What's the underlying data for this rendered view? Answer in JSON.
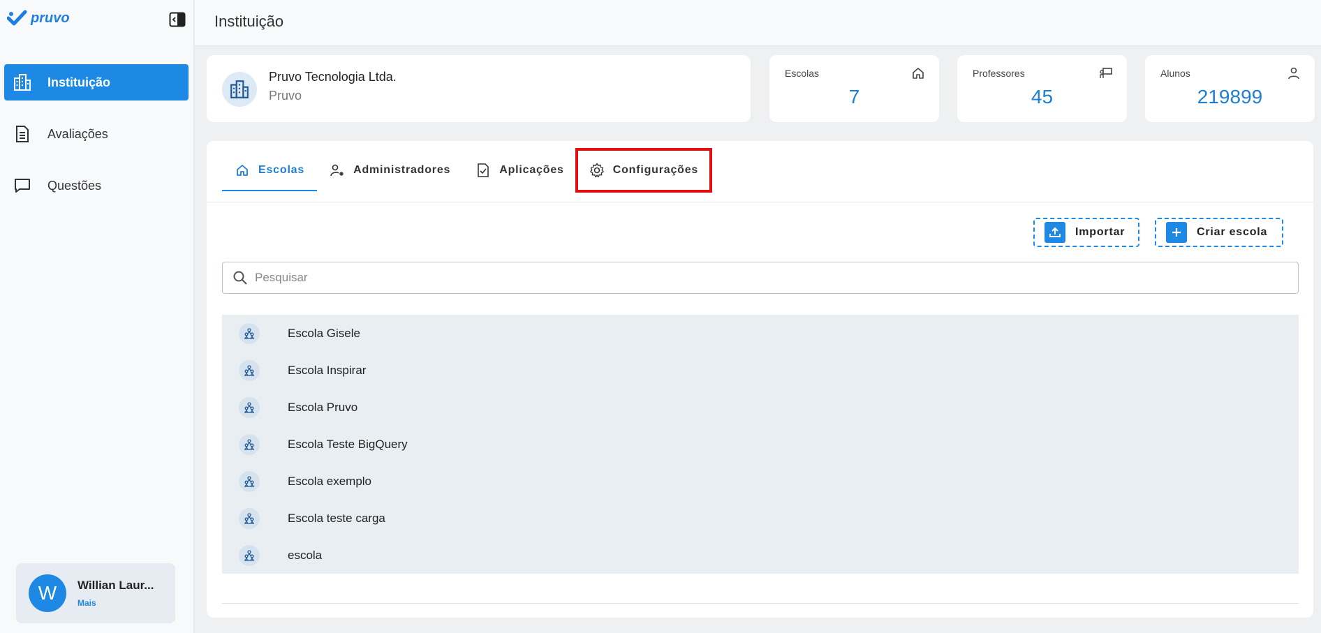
{
  "app": {
    "logo_text": "pruvo"
  },
  "header": {
    "title": "Instituição"
  },
  "sidebar": {
    "items": [
      {
        "label": "Instituição",
        "icon": "building-icon",
        "active": true
      },
      {
        "label": "Avaliações",
        "icon": "document-icon",
        "active": false
      },
      {
        "label": "Questões",
        "icon": "chat-icon",
        "active": false
      }
    ],
    "user": {
      "initial": "W",
      "name": "Willian Laur...",
      "more": "Mais"
    }
  },
  "institution": {
    "name": "Pruvo Tecnologia Ltda.",
    "short_name": "Pruvo"
  },
  "stats": [
    {
      "label": "Escolas",
      "value": "7",
      "icon": "home-icon"
    },
    {
      "label": "Professores",
      "value": "45",
      "icon": "teacher-icon"
    },
    {
      "label": "Alunos",
      "value": "219899",
      "icon": "person-icon"
    }
  ],
  "tabs": [
    {
      "label": "Escolas",
      "icon": "home-icon",
      "active": true
    },
    {
      "label": "Administradores",
      "icon": "admin-user-icon",
      "active": false
    },
    {
      "label": "Aplicações",
      "icon": "file-check-icon",
      "active": false
    },
    {
      "label": "Configurações",
      "icon": "gear-icon",
      "active": false,
      "highlighted": true
    }
  ],
  "actions": {
    "import_label": "Importar",
    "create_label": "Criar escola"
  },
  "search": {
    "placeholder": "Pesquisar",
    "value": ""
  },
  "schools": [
    "Escola Gisele",
    "Escola Inspirar",
    "Escola Pruvo",
    "Escola Teste BigQuery",
    "Escola exemplo",
    "Escola teste carga",
    "escola"
  ],
  "colors": {
    "accent": "#1e88e5",
    "highlight": "#e01010"
  }
}
